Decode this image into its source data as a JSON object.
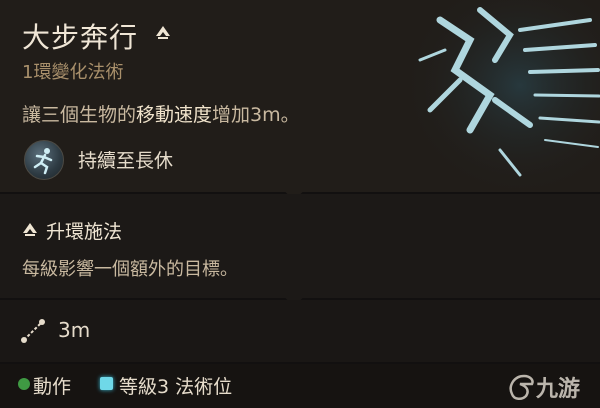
{
  "spell": {
    "name": "大步奔行",
    "school": "1環變化法術",
    "description_prefix": "讓三個生物的",
    "description_highlight": "移動速度",
    "description_suffix": "增加3m。",
    "duration": "持續至長休"
  },
  "upcast": {
    "title": "升環施法",
    "description": "每級影響一個額外的目標。"
  },
  "range": {
    "value": "3m"
  },
  "cost": {
    "action_label": "動作",
    "slot_label": "等級3 法術位"
  },
  "watermark": {
    "text": "九游"
  },
  "colors": {
    "title": "#f0e6d6",
    "school": "#a9906b",
    "action_dot": "#3f9a43",
    "spell_slot": "#6fd8e8"
  },
  "icons": {
    "upcast": "chevron-up-icon",
    "duration": "running-figure-icon",
    "range": "range-line-icon"
  }
}
